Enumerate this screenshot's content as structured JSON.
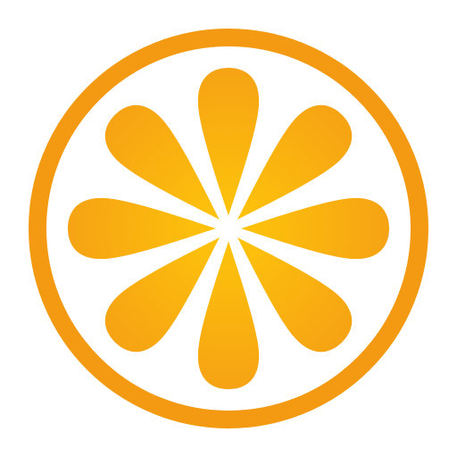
{
  "logo": {
    "name": "orange-slice-logo",
    "colors": {
      "rim": "#f39a12",
      "segment_inner": "#ffc60a",
      "segment_outer": "#f5a114",
      "background": "#ffffff"
    },
    "segment_count": 8
  }
}
